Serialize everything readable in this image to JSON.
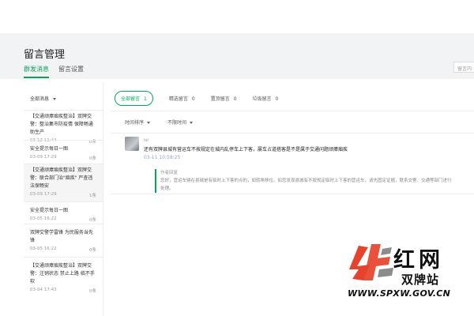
{
  "header": {
    "title": "留言管理",
    "tabs": [
      {
        "label": "群发消息"
      },
      {
        "label": "留言设置"
      }
    ],
    "search_placeholder": "留言内"
  },
  "sidebar": {
    "filter_label": "全部消息",
    "items": [
      {
        "title": "【交通顽瘴痼疾整治】双牌交警：整治集市防疫情 保障畅通助生产",
        "time": "03-12 11:44",
        "count": "0条"
      },
      {
        "title": "安全提示每日一图",
        "time": "03-09 17:29",
        "count": "0条"
      },
      {
        "title": "【交通顽瘴痼疾整治】双牌交警：联合部门治\"痼疾\" 严查违法保畅安",
        "time": "03-09 17:29",
        "count": "1条"
      },
      {
        "title": "安全提示每日一图",
        "time": "03-05 16:22",
        "count": "0条"
      },
      {
        "title": "双牌交警学雷锋 为民服务当先锋",
        "time": "03-05 16:22",
        "count": "0条"
      },
      {
        "title": "【交通顽瘴痼疾整治】双牌交警：注销状态 禁止上路 临不手软",
        "time": "03-04 17:43",
        "count": "0条"
      }
    ]
  },
  "main": {
    "filters": [
      {
        "label": "全部留言",
        "count": "1"
      },
      {
        "label": "精选留言",
        "count": "0"
      },
      {
        "label": "置顶留言",
        "count": "0"
      },
      {
        "label": "垃圾留言",
        "count": "0"
      }
    ],
    "sorts": [
      {
        "label": "时间排序"
      },
      {
        "label": "不限时间"
      }
    ],
    "message": {
      "nickname": "ivl",
      "text": "还有双牌县城有营运车不按规定在城内乱停车上下客，屡车占道搭客是不是属于交通问题顽瘴痼疾",
      "time": "03-11 10:58:25",
      "reply_label": "作者回复",
      "reply_text": "您好，营运车辆在县城是有临时上下客的点的，如转角移位。如您发现县城有不按规定临时上下客的营运车，请先固定证据，联系交警、交通等部门进行处理。"
    }
  },
  "watermark": {
    "title": "红网",
    "subtitle": "双牌站",
    "url": "WWW.SPXW.GOV.CN"
  },
  "colors": {
    "accent": "#07a35a",
    "logo_red": "#e6432c",
    "logo_gray": "#8c8c8c"
  }
}
